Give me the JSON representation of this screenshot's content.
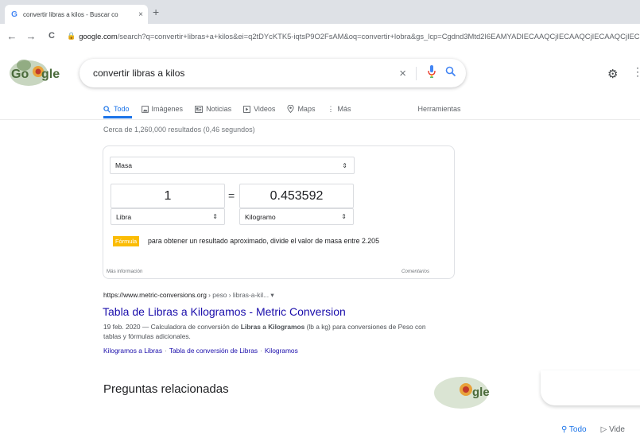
{
  "browser": {
    "tab_title": "convertir libras a kilos - Buscar co",
    "tab_favicon": "G",
    "tab_close": "×",
    "new_tab": "+",
    "back": "←",
    "forward": "→",
    "reload": "C",
    "url_host": "google.com",
    "url_rest": "/search?q=convertir+libras+a+kilos&ei=q2tDYcKTK5-iqtsP9O2FsAM&oq=convertir+lobra&gs_lcp=Cgdnd3Mtd2I6EAMYADIECAAQCjIECAAQCjIECAAQCjIEC"
  },
  "search": {
    "query": "convertir libras a kilos",
    "clear_icon": "×"
  },
  "tabs": [
    {
      "label": "Todo",
      "icon": "search-icon"
    },
    {
      "label": "Imágenes",
      "icon": "image-icon"
    },
    {
      "label": "Noticias",
      "icon": "news-icon"
    },
    {
      "label": "Videos",
      "icon": "video-icon"
    },
    {
      "label": "Maps",
      "icon": "location-icon"
    },
    {
      "label": "Más",
      "icon": "more-icon"
    }
  ],
  "tools_label": "Herramientas",
  "result_stats": "Cerca de 1,260,000 resultados (0,46 segundos)",
  "converter": {
    "quantity": "Masa",
    "from_value": "1",
    "to_value": "0.453592",
    "equals": "=",
    "from_unit": "Libra",
    "to_unit": "Kilogramo",
    "formula_badge": "Fórmula",
    "formula_text": "para obtener un resultado aproximado, divide el valor de masa entre 2.205",
    "more_info": "Más información",
    "feedback": "Comentarios"
  },
  "result": {
    "url_host": "https://www.metric-conversions.org",
    "url_path": " › peso › libras-a-kil... ▾",
    "title": "Tabla de Libras a Kilogramos - Metric Conversion",
    "snippet_date": "19 feb. 2020 — ",
    "snippet_a": "Calculadora de conversión de ",
    "snippet_bold1": "Libras a Kilogramos",
    "snippet_b": " (lb a kg) para conversiones de Peso con tablas y fórmulas adicionales.",
    "sitelinks": [
      "Kilogramos a Libras",
      "Tabla de conversión de Libras",
      "Kilogramos"
    ]
  },
  "related_heading": "Preguntas relacionadas",
  "ghost_tabs": [
    "Todo",
    "Vide"
  ],
  "colors": {
    "blue": "#1a73e8",
    "link": "#1a0dab",
    "formula_badge": "#fbbc04"
  }
}
